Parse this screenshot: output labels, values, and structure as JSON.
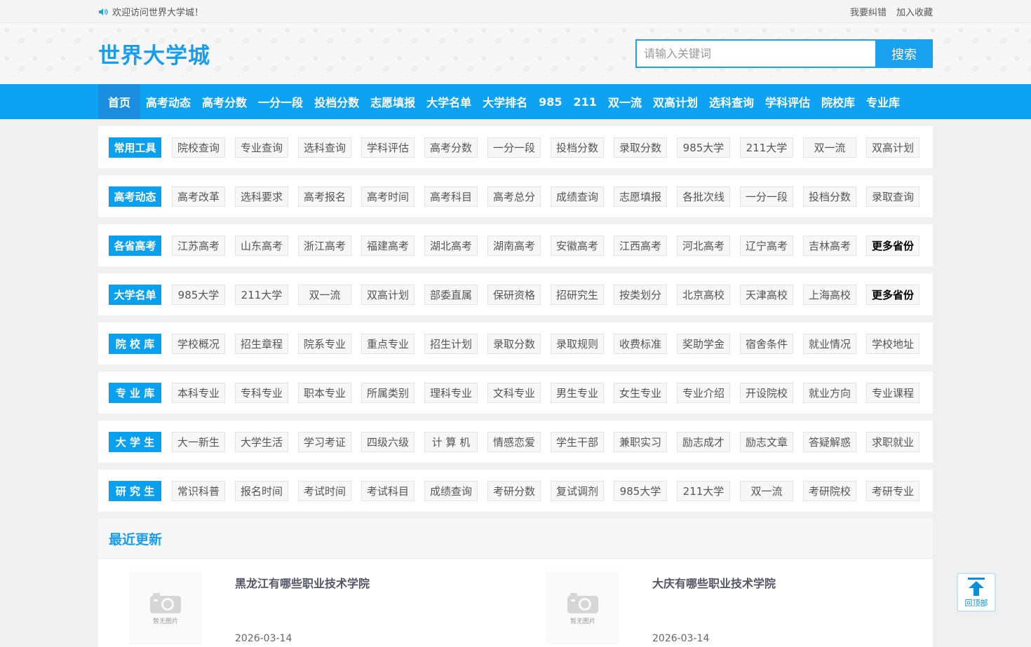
{
  "topbar": {
    "welcome": "欢迎访问世界大学城！",
    "links": [
      "我要纠错",
      "加入收藏"
    ]
  },
  "header": {
    "logo": "世界大学城",
    "search_placeholder": "请输入关键词",
    "search_button": "搜索"
  },
  "nav": [
    "首页",
    "高考动态",
    "高考分数",
    "一分一段",
    "投档分数",
    "志愿填报",
    "大学名单",
    "大学排名",
    "985",
    "211",
    "双一流",
    "双高计划",
    "选科查询",
    "学科评估",
    "院校库",
    "专业库"
  ],
  "rows": [
    {
      "tag": "常用工具",
      "items": [
        "院校查询",
        "专业查询",
        "选科查询",
        "学科评估",
        "高考分数",
        "一分一段",
        "投档分数",
        "录取分数",
        "985大学",
        "211大学",
        "双一流",
        "双高计划"
      ]
    },
    {
      "tag": "高考动态",
      "items": [
        "高考改革",
        "选科要求",
        "高考报名",
        "高考时间",
        "高考科目",
        "高考总分",
        "成绩查询",
        "志愿填报",
        "各批次线",
        "一分一段",
        "投档分数",
        "录取查询"
      ]
    },
    {
      "tag": "各省高考",
      "items": [
        "江苏高考",
        "山东高考",
        "浙江高考",
        "福建高考",
        "湖北高考",
        "湖南高考",
        "安徽高考",
        "江西高考",
        "河北高考",
        "辽宁高考",
        "吉林高考"
      ],
      "more": "更多省份"
    },
    {
      "tag": "大学名单",
      "items": [
        "985大学",
        "211大学",
        "双一流",
        "双高计划",
        "部委直属",
        "保研资格",
        "招研究生",
        "按类划分",
        "北京高校",
        "天津高校",
        "上海高校"
      ],
      "more": "更多省份"
    },
    {
      "tag": "院 校 库",
      "items": [
        "学校概况",
        "招生章程",
        "院系专业",
        "重点专业",
        "招生计划",
        "录取分数",
        "录取规则",
        "收费标准",
        "奖助学金",
        "宿舍条件",
        "就业情况",
        "学校地址"
      ]
    },
    {
      "tag": "专 业 库",
      "items": [
        "本科专业",
        "专科专业",
        "职本专业",
        "所属类别",
        "理科专业",
        "文科专业",
        "男生专业",
        "女生专业",
        "专业介绍",
        "开设院校",
        "就业方向",
        "专业课程"
      ]
    },
    {
      "tag": "大 学 生",
      "items": [
        "大一新生",
        "大学生活",
        "学习考证",
        "四级六级",
        "计 算 机",
        "情感恋爱",
        "学生干部",
        "兼职实习",
        "励志成才",
        "励志文章",
        "答疑解惑",
        "求职就业"
      ]
    },
    {
      "tag": "研 究 生",
      "items": [
        "常识科普",
        "报名时间",
        "考试时间",
        "考试科目",
        "成绩查询",
        "考研分数",
        "复试调剂",
        "985大学",
        "211大学",
        "双一流",
        "考研院校",
        "考研专业"
      ]
    }
  ],
  "recent": {
    "heading": "最近更新",
    "no_image_label": "暂无图片",
    "articles": [
      {
        "title": "黑龙江有哪些职业技术学院",
        "date": "2026-03-14"
      },
      {
        "title": "大庆有哪些职业技术学院",
        "date": "2026-03-14"
      }
    ]
  },
  "back_to_top": "回顶部"
}
